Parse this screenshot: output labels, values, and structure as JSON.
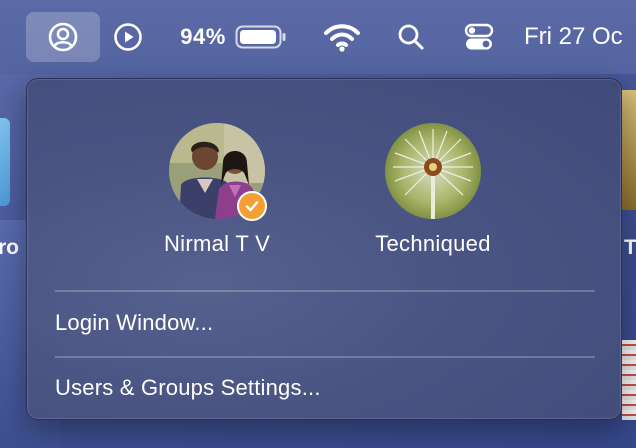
{
  "menubar": {
    "battery_percent": "94%",
    "clock": "Fri 27 Oc",
    "icons": [
      "user-circle-icon",
      "play-circle-icon",
      "battery-icon",
      "wifi-icon",
      "search-icon",
      "control-center-icon"
    ]
  },
  "desktop": {
    "left_label": "ro",
    "right_label": "T"
  },
  "panel": {
    "users": [
      {
        "name": "Nirmal T V",
        "current": true,
        "avatar": "couple-photo"
      },
      {
        "name": "Techniqued",
        "current": false,
        "avatar": "dandelion-photo"
      }
    ],
    "menu_items": [
      {
        "label": "Login Window..."
      },
      {
        "label": "Users & Groups Settings..."
      }
    ]
  },
  "colors": {
    "accent_badge": "#f2a033",
    "panel_bg": "#4a5483",
    "menubar_bg": "#5565a2"
  }
}
